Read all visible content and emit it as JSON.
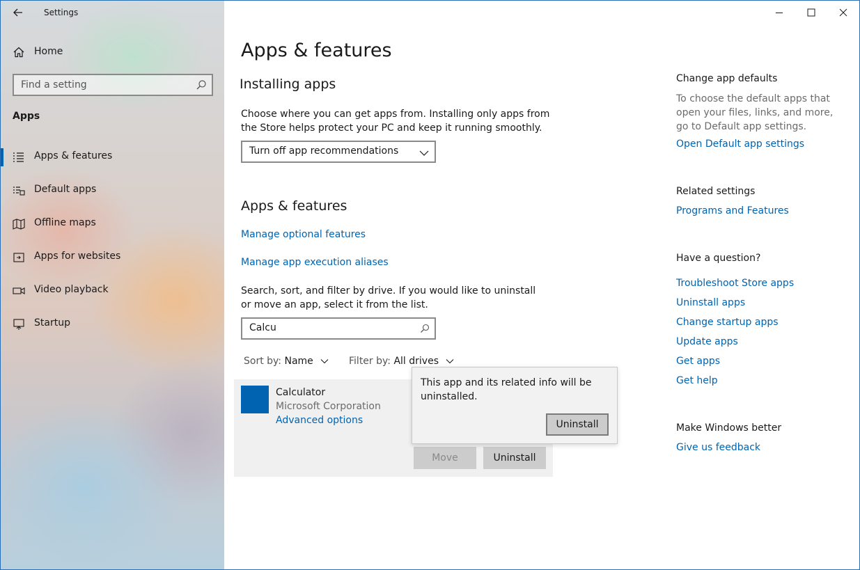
{
  "window": {
    "title": "Settings",
    "controls": [
      "minimize",
      "maximize",
      "close"
    ]
  },
  "sidebar": {
    "home_label": "Home",
    "search_placeholder": "Find a setting",
    "section_label": "Apps",
    "items": [
      {
        "label": "Apps & features",
        "icon": "list-icon",
        "active": true
      },
      {
        "label": "Default apps",
        "icon": "default-apps-icon",
        "active": false
      },
      {
        "label": "Offline maps",
        "icon": "map-icon",
        "active": false
      },
      {
        "label": "Apps for websites",
        "icon": "web-app-icon",
        "active": false
      },
      {
        "label": "Video playback",
        "icon": "video-icon",
        "active": false
      },
      {
        "label": "Startup",
        "icon": "startup-icon",
        "active": false
      }
    ]
  },
  "main": {
    "page_title": "Apps & features",
    "installing": {
      "heading": "Installing apps",
      "description": "Choose where you can get apps from. Installing only apps from the Store helps protect your PC and keep it running smoothly.",
      "dropdown_value": "Turn off app recommendations"
    },
    "apps_features": {
      "heading": "Apps & features",
      "link_optional": "Manage optional features",
      "link_aliases": "Manage app execution aliases",
      "description": "Search, sort, and filter by drive. If you would like to uninstall or move an app, select it from the list.",
      "search_value": "Calcu",
      "sort_key": "Sort by:",
      "sort_value": "Name",
      "filter_key": "Filter by:",
      "filter_value": "All drives"
    },
    "app": {
      "name": "Calculator",
      "publisher": "Microsoft Corporation",
      "advanced_link": "Advanced options",
      "move_label": "Move",
      "uninstall_label": "Uninstall",
      "tile_color": "#0063b1"
    },
    "flyout": {
      "message": "This app and its related info will be uninstalled.",
      "button_label": "Uninstall"
    }
  },
  "right": {
    "defaults": {
      "heading": "Change app defaults",
      "text": "To choose the default apps that open your files, links, and more, go to Default app settings.",
      "link": "Open Default app settings"
    },
    "related": {
      "heading": "Related settings",
      "link": "Programs and Features"
    },
    "question": {
      "heading": "Have a question?",
      "links": [
        "Troubleshoot Store apps",
        "Uninstall apps",
        "Change startup apps",
        "Update apps",
        "Get apps",
        "Get help"
      ]
    },
    "better": {
      "heading": "Make Windows better",
      "link": "Give us feedback"
    }
  },
  "colors": {
    "accent": "#0063b1",
    "window_border": "#2a6fb5"
  }
}
